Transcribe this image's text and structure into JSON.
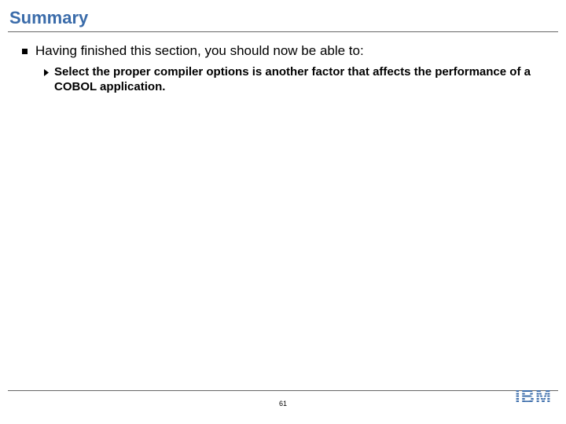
{
  "title": "Summary",
  "content": {
    "level1": "Having finished this section, you should now be able to:",
    "level2": "Select the proper compiler options is another factor that affects the performance of a COBOL application."
  },
  "footer": {
    "page_number": "61",
    "logo_text": "IBM"
  }
}
